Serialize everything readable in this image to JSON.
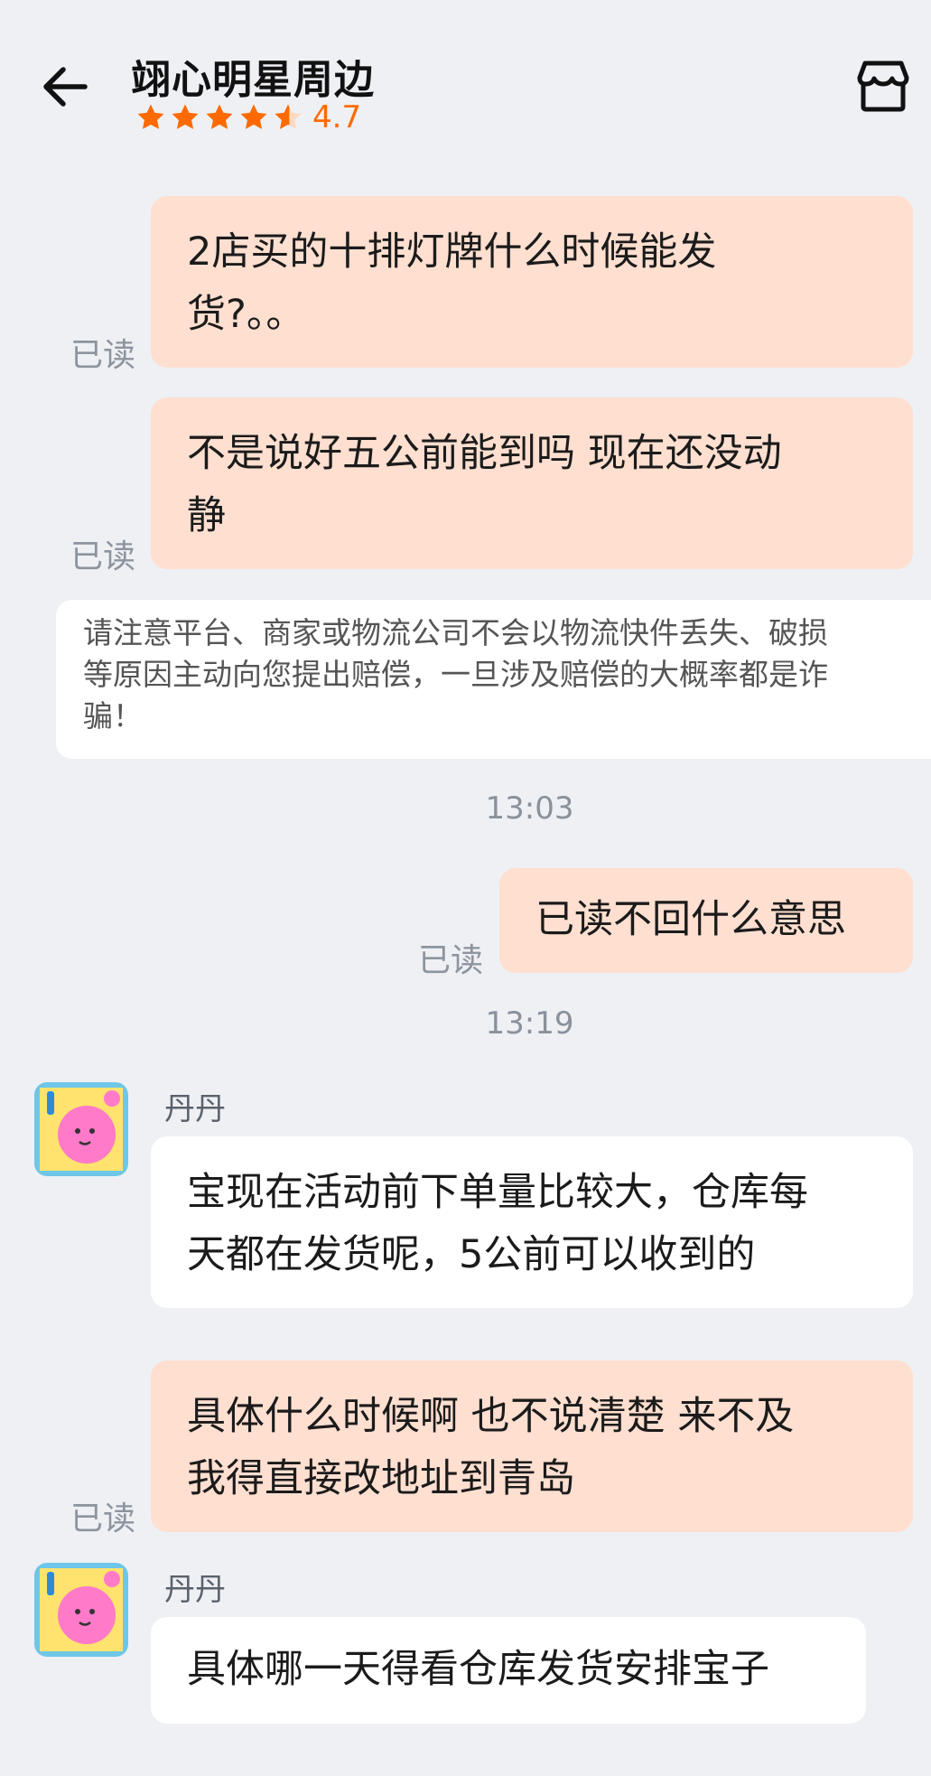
{
  "header": {
    "shop_name": "翊心明星周边",
    "rating": "4.7",
    "colors": {
      "star": "#ff6a00"
    }
  },
  "icons": {
    "back": "arrow-left-icon",
    "shop": "store-icon",
    "star": "star-icon"
  },
  "messages": [
    {
      "from": "me",
      "text": "2店买的十排灯牌什么时候能发\n货?。。",
      "status": "已读"
    },
    {
      "from": "me",
      "text": "不是说好五公前能到吗 现在还没动\n静",
      "status": "已读"
    },
    {
      "type": "notice",
      "text": "请注意平台、商家或物流公司不会以物流快件丢失、破损\n等原因主动向您提出赔偿，一旦涉及赔偿的大概率都是诈\n骗！"
    },
    {
      "type": "time",
      "text": "13:03"
    },
    {
      "from": "me",
      "text": "已读不回什么意思",
      "status": "已读"
    },
    {
      "type": "time",
      "text": "13:19"
    },
    {
      "from": "them",
      "sender": "丹丹",
      "text": "宝现在活动前下单量比较大，仓库每\n天都在发货呢，5公前可以收到的"
    },
    {
      "from": "me",
      "text": "具体什么时候啊 也不说清楚 来不及\n我得直接改地址到青岛",
      "status": "已读"
    },
    {
      "from": "them",
      "sender": "丹丹",
      "text": "具体哪一天得看仓库发货安排宝子"
    }
  ],
  "colors": {
    "my_bubble": "#ffdfd0",
    "their_bubble": "#ffffff",
    "background": "#eef0f4"
  }
}
